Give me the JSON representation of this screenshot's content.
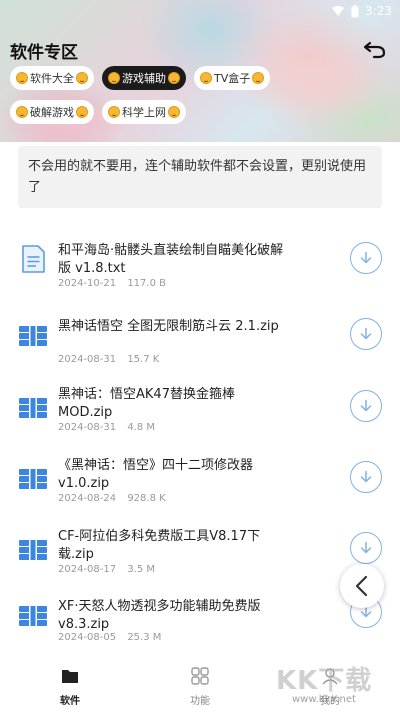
{
  "status_bar": {
    "time": "3:23"
  },
  "header": {
    "title": "软件专区"
  },
  "categories": [
    {
      "label": "软件大全",
      "active": false
    },
    {
      "label": "游戏辅助",
      "active": true
    },
    {
      "label": "TV盒子",
      "active": false
    },
    {
      "label": "破解游戏",
      "active": false
    },
    {
      "label": "科学上网",
      "active": false
    }
  ],
  "notice": {
    "text": "不会用的就不要用，连个辅助软件都不会设置，更别说使用了"
  },
  "files": [
    {
      "name": "和平海岛·骷髅头直装绘制自瞄美化破解版 v1.8.txt",
      "date": "2024-10-21",
      "size": "117.0 B",
      "type": "txt"
    },
    {
      "name": "黑神话悟空 全图无限制筋斗云 2.1.zip",
      "date": "2024-08-31",
      "size": "15.7 K",
      "type": "zip"
    },
    {
      "name": "黑神话：悟空AK47替换金箍棒 MOD.zip",
      "date": "2024-08-31",
      "size": "4.8 M",
      "type": "zip"
    },
    {
      "name": "《黑神话：悟空》四十二项修改器 v1.0.zip",
      "date": "2024-08-24",
      "size": "928.8 K",
      "type": "zip"
    },
    {
      "name": "CF-阿拉伯多科免费版工具V8.17下载.zip",
      "date": "2024-08-17",
      "size": "3.5 M",
      "type": "zip"
    },
    {
      "name": "XF·天怒人物透视多功能辅助免费版 v8.3.zip",
      "date": "2024-08-05",
      "size": "25.3 M",
      "type": "zip"
    }
  ],
  "bottom_nav": [
    {
      "label": "软件",
      "icon": "folder-icon",
      "active": true
    },
    {
      "label": "功能",
      "icon": "grid-icon",
      "active": false
    },
    {
      "label": "我的",
      "icon": "user-icon",
      "active": false
    }
  ],
  "watermark": {
    "main": "KK下载",
    "sub": "www.kkx.net"
  }
}
